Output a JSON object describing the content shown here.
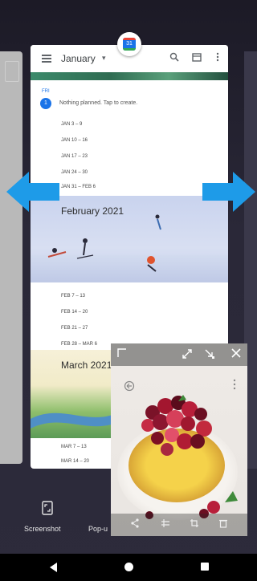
{
  "calendar": {
    "month": "January",
    "dropdown": "▾",
    "today_dow": "FRI",
    "today_day": "1",
    "today_text": "Nothing planned. Tap to create.",
    "january_weeks": [
      "JAN 3 – 9",
      "JAN 10 – 16",
      "JAN 17 – 23",
      "JAN 24 – 30",
      "JAN 31 – FEB 6"
    ],
    "february_title": "February 2021",
    "february_weeks": [
      "FEB 7 – 13",
      "FEB 14 – 20",
      "FEB 21 – 27",
      "FEB 28 – MAR 6"
    ],
    "march_title": "March 2021",
    "march_weeks": [
      "MAR 7 – 13",
      "MAR 14 – 20"
    ],
    "app_icon_day": "31"
  },
  "actions": {
    "screenshot_label": "Screenshot",
    "popup_label": "Pop-u"
  },
  "colors": {
    "arrow": "#1e9be8",
    "today_badge": "#1a73e8",
    "nav_bg": "#000000"
  }
}
